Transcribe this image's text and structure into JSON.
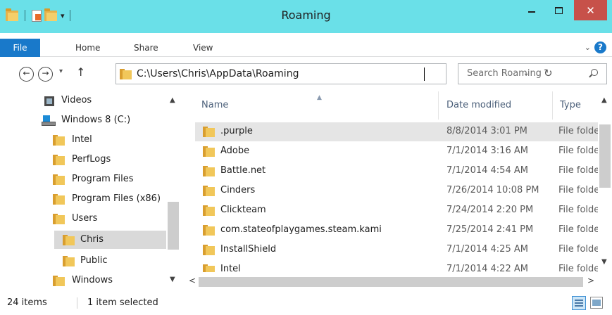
{
  "window": {
    "title": "Roaming",
    "close_glyph": "✕",
    "colors": {
      "titlebar": "#6ae0e8",
      "close": "#c7514a",
      "file_tab": "#1979ca"
    }
  },
  "quick_access": {
    "dropdown_glyph": "▾"
  },
  "ribbon": {
    "tabs": [
      "File",
      "Home",
      "Share",
      "View"
    ],
    "expand_glyph": "⌄",
    "help_glyph": "?"
  },
  "nav": {
    "back_glyph": "←",
    "forward_glyph": "→",
    "recent_glyph": "▾",
    "up_glyph": "↑"
  },
  "address": {
    "path": "C:\\Users\\Chris\\AppData\\Roaming",
    "dropdown_glyph": "⌄",
    "refresh_glyph": "↻"
  },
  "search": {
    "placeholder": "Search Roaming"
  },
  "nav_pane": {
    "items": [
      {
        "label": "Videos",
        "icon": "videos-icon",
        "level": 1
      },
      {
        "label": "Windows 8 (C:)",
        "icon": "drive-icon",
        "level": 1
      },
      {
        "label": "Intel",
        "icon": "folder-icon",
        "level": 2
      },
      {
        "label": "PerfLogs",
        "icon": "folder-icon",
        "level": 2
      },
      {
        "label": "Program Files",
        "icon": "folder-icon",
        "level": 2
      },
      {
        "label": "Program Files (x86)",
        "icon": "folder-icon",
        "level": 2
      },
      {
        "label": "Users",
        "icon": "folder-icon",
        "level": 2
      },
      {
        "label": "Chris",
        "icon": "folder-icon",
        "level": 3,
        "selected": true
      },
      {
        "label": "Public",
        "icon": "folder-icon",
        "level": 3
      },
      {
        "label": "Windows",
        "icon": "folder-icon",
        "level": 2
      }
    ]
  },
  "columns": {
    "name": "Name",
    "date_modified": "Date modified",
    "type": "Type"
  },
  "files": [
    {
      "name": ".purple",
      "date": "8/8/2014 3:01 PM",
      "type": "File folder",
      "selected": true
    },
    {
      "name": "Adobe",
      "date": "7/1/2014 3:16 AM",
      "type": "File folder"
    },
    {
      "name": "Battle.net",
      "date": "7/1/2014 4:54 AM",
      "type": "File folder"
    },
    {
      "name": "Cinders",
      "date": "7/26/2014 10:08 PM",
      "type": "File folder"
    },
    {
      "name": "Clickteam",
      "date": "7/24/2014 2:20 PM",
      "type": "File folder"
    },
    {
      "name": "com.stateofplaygames.steam.kami",
      "date": "7/25/2014 2:41 PM",
      "type": "File folder"
    },
    {
      "name": "InstallShield",
      "date": "7/1/2014 4:25 AM",
      "type": "File folder"
    },
    {
      "name": "Intel",
      "date": "7/1/2014 4:22 AM",
      "type": "File folder"
    }
  ],
  "scroll": {
    "up": "▲",
    "down": "▼",
    "left": "<",
    "right": ">"
  },
  "status": {
    "item_count": "24 items",
    "selection": "1 item selected"
  }
}
